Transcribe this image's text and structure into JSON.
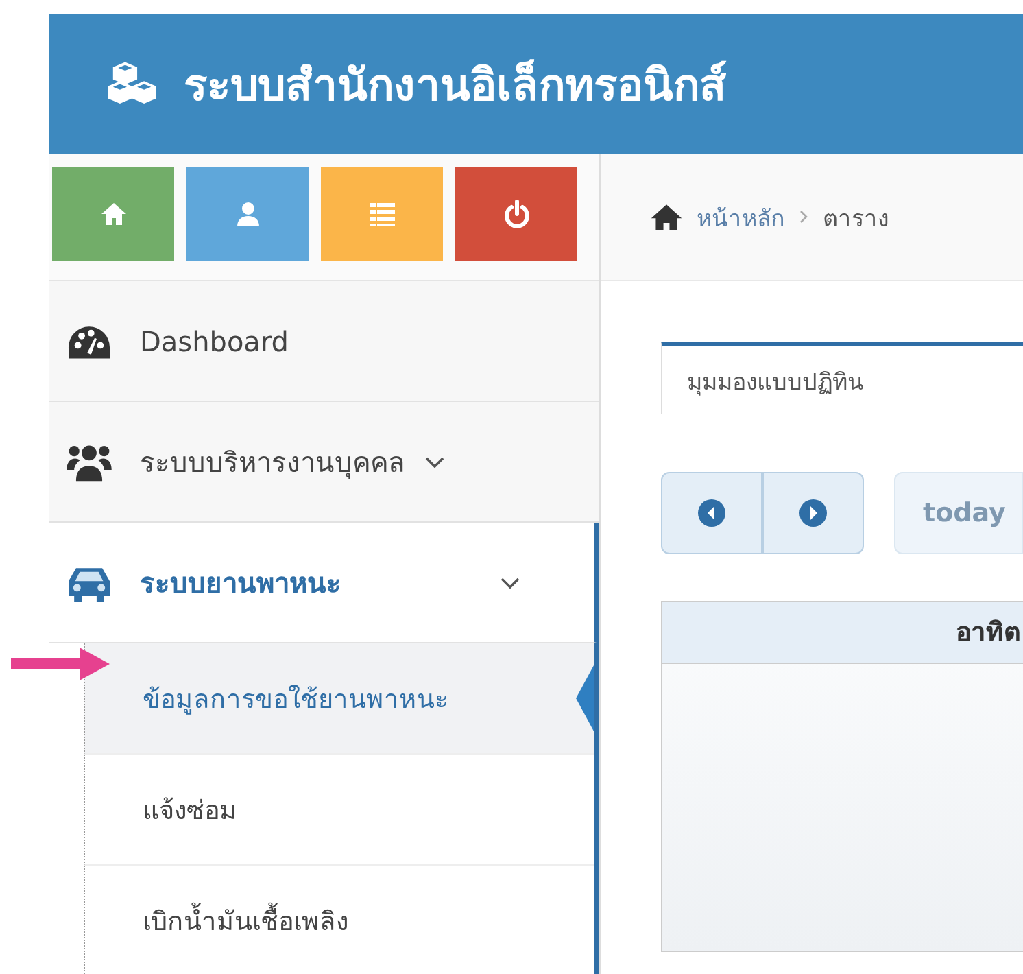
{
  "header": {
    "title": "ระบบสำนักงานอิเล็กทรอนิกส์"
  },
  "quick_buttons": [
    {
      "kind": "home",
      "color": "#72ad69"
    },
    {
      "kind": "user",
      "color": "#5fa7da"
    },
    {
      "kind": "list",
      "color": "#fbb549"
    },
    {
      "kind": "power",
      "color": "#d24e3b"
    }
  ],
  "sidebar": {
    "items": [
      {
        "label": "Dashboard",
        "kind": "link"
      },
      {
        "label": "ระบบบริหารงานบุคคล",
        "kind": "group",
        "expanded": false
      },
      {
        "label": "ระบบยานพาหนะ",
        "kind": "group",
        "expanded": true,
        "children": [
          {
            "label": "ข้อมูลการขอใช้ยานพาหนะ",
            "selected": true
          },
          {
            "label": "แจ้งซ่อม",
            "selected": false
          },
          {
            "label": "เบิกน้ำมันเชื้อเพลิง",
            "selected": false
          }
        ]
      }
    ]
  },
  "breadcrumb": [
    "หน้าหลัก",
    "ตาราง"
  ],
  "tabs": [
    {
      "label": "มุมมองแบบปฏิทิน",
      "selected": true
    }
  ],
  "toolbar": {
    "today": {
      "label": "today",
      "disabled": true
    }
  },
  "calendar": {
    "columns": [
      "อาทิต"
    ]
  }
}
